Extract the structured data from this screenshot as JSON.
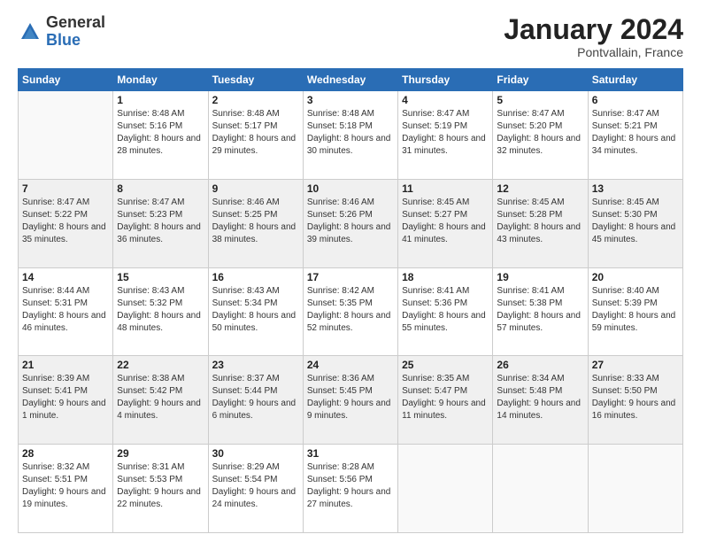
{
  "logo": {
    "general": "General",
    "blue": "Blue"
  },
  "header": {
    "month": "January 2024",
    "location": "Pontvallain, France"
  },
  "weekdays": [
    "Sunday",
    "Monday",
    "Tuesday",
    "Wednesday",
    "Thursday",
    "Friday",
    "Saturday"
  ],
  "weeks": [
    [
      {
        "day": "",
        "empty": true
      },
      {
        "day": "1",
        "sunrise": "Sunrise: 8:48 AM",
        "sunset": "Sunset: 5:16 PM",
        "daylight": "Daylight: 8 hours and 28 minutes."
      },
      {
        "day": "2",
        "sunrise": "Sunrise: 8:48 AM",
        "sunset": "Sunset: 5:17 PM",
        "daylight": "Daylight: 8 hours and 29 minutes."
      },
      {
        "day": "3",
        "sunrise": "Sunrise: 8:48 AM",
        "sunset": "Sunset: 5:18 PM",
        "daylight": "Daylight: 8 hours and 30 minutes."
      },
      {
        "day": "4",
        "sunrise": "Sunrise: 8:47 AM",
        "sunset": "Sunset: 5:19 PM",
        "daylight": "Daylight: 8 hours and 31 minutes."
      },
      {
        "day": "5",
        "sunrise": "Sunrise: 8:47 AM",
        "sunset": "Sunset: 5:20 PM",
        "daylight": "Daylight: 8 hours and 32 minutes."
      },
      {
        "day": "6",
        "sunrise": "Sunrise: 8:47 AM",
        "sunset": "Sunset: 5:21 PM",
        "daylight": "Daylight: 8 hours and 34 minutes."
      }
    ],
    [
      {
        "day": "7",
        "sunrise": "Sunrise: 8:47 AM",
        "sunset": "Sunset: 5:22 PM",
        "daylight": "Daylight: 8 hours and 35 minutes."
      },
      {
        "day": "8",
        "sunrise": "Sunrise: 8:47 AM",
        "sunset": "Sunset: 5:23 PM",
        "daylight": "Daylight: 8 hours and 36 minutes."
      },
      {
        "day": "9",
        "sunrise": "Sunrise: 8:46 AM",
        "sunset": "Sunset: 5:25 PM",
        "daylight": "Daylight: 8 hours and 38 minutes."
      },
      {
        "day": "10",
        "sunrise": "Sunrise: 8:46 AM",
        "sunset": "Sunset: 5:26 PM",
        "daylight": "Daylight: 8 hours and 39 minutes."
      },
      {
        "day": "11",
        "sunrise": "Sunrise: 8:45 AM",
        "sunset": "Sunset: 5:27 PM",
        "daylight": "Daylight: 8 hours and 41 minutes."
      },
      {
        "day": "12",
        "sunrise": "Sunrise: 8:45 AM",
        "sunset": "Sunset: 5:28 PM",
        "daylight": "Daylight: 8 hours and 43 minutes."
      },
      {
        "day": "13",
        "sunrise": "Sunrise: 8:45 AM",
        "sunset": "Sunset: 5:30 PM",
        "daylight": "Daylight: 8 hours and 45 minutes."
      }
    ],
    [
      {
        "day": "14",
        "sunrise": "Sunrise: 8:44 AM",
        "sunset": "Sunset: 5:31 PM",
        "daylight": "Daylight: 8 hours and 46 minutes."
      },
      {
        "day": "15",
        "sunrise": "Sunrise: 8:43 AM",
        "sunset": "Sunset: 5:32 PM",
        "daylight": "Daylight: 8 hours and 48 minutes."
      },
      {
        "day": "16",
        "sunrise": "Sunrise: 8:43 AM",
        "sunset": "Sunset: 5:34 PM",
        "daylight": "Daylight: 8 hours and 50 minutes."
      },
      {
        "day": "17",
        "sunrise": "Sunrise: 8:42 AM",
        "sunset": "Sunset: 5:35 PM",
        "daylight": "Daylight: 8 hours and 52 minutes."
      },
      {
        "day": "18",
        "sunrise": "Sunrise: 8:41 AM",
        "sunset": "Sunset: 5:36 PM",
        "daylight": "Daylight: 8 hours and 55 minutes."
      },
      {
        "day": "19",
        "sunrise": "Sunrise: 8:41 AM",
        "sunset": "Sunset: 5:38 PM",
        "daylight": "Daylight: 8 hours and 57 minutes."
      },
      {
        "day": "20",
        "sunrise": "Sunrise: 8:40 AM",
        "sunset": "Sunset: 5:39 PM",
        "daylight": "Daylight: 8 hours and 59 minutes."
      }
    ],
    [
      {
        "day": "21",
        "sunrise": "Sunrise: 8:39 AM",
        "sunset": "Sunset: 5:41 PM",
        "daylight": "Daylight: 9 hours and 1 minute."
      },
      {
        "day": "22",
        "sunrise": "Sunrise: 8:38 AM",
        "sunset": "Sunset: 5:42 PM",
        "daylight": "Daylight: 9 hours and 4 minutes."
      },
      {
        "day": "23",
        "sunrise": "Sunrise: 8:37 AM",
        "sunset": "Sunset: 5:44 PM",
        "daylight": "Daylight: 9 hours and 6 minutes."
      },
      {
        "day": "24",
        "sunrise": "Sunrise: 8:36 AM",
        "sunset": "Sunset: 5:45 PM",
        "daylight": "Daylight: 9 hours and 9 minutes."
      },
      {
        "day": "25",
        "sunrise": "Sunrise: 8:35 AM",
        "sunset": "Sunset: 5:47 PM",
        "daylight": "Daylight: 9 hours and 11 minutes."
      },
      {
        "day": "26",
        "sunrise": "Sunrise: 8:34 AM",
        "sunset": "Sunset: 5:48 PM",
        "daylight": "Daylight: 9 hours and 14 minutes."
      },
      {
        "day": "27",
        "sunrise": "Sunrise: 8:33 AM",
        "sunset": "Sunset: 5:50 PM",
        "daylight": "Daylight: 9 hours and 16 minutes."
      }
    ],
    [
      {
        "day": "28",
        "sunrise": "Sunrise: 8:32 AM",
        "sunset": "Sunset: 5:51 PM",
        "daylight": "Daylight: 9 hours and 19 minutes."
      },
      {
        "day": "29",
        "sunrise": "Sunrise: 8:31 AM",
        "sunset": "Sunset: 5:53 PM",
        "daylight": "Daylight: 9 hours and 22 minutes."
      },
      {
        "day": "30",
        "sunrise": "Sunrise: 8:29 AM",
        "sunset": "Sunset: 5:54 PM",
        "daylight": "Daylight: 9 hours and 24 minutes."
      },
      {
        "day": "31",
        "sunrise": "Sunrise: 8:28 AM",
        "sunset": "Sunset: 5:56 PM",
        "daylight": "Daylight: 9 hours and 27 minutes."
      },
      {
        "day": "",
        "empty": true
      },
      {
        "day": "",
        "empty": true
      },
      {
        "day": "",
        "empty": true
      }
    ]
  ]
}
